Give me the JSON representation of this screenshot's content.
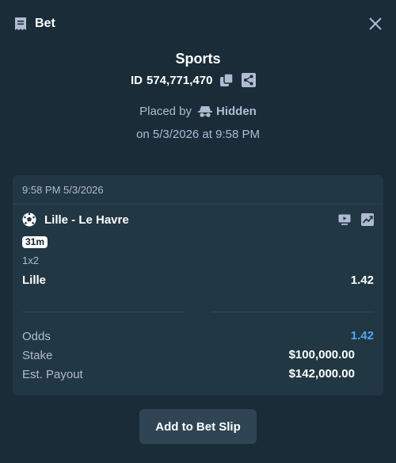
{
  "header": {
    "title": "Bet"
  },
  "bet": {
    "category": "Sports",
    "id_prefix": "ID",
    "id_value": "574,771,470",
    "placed_by_label": "Placed by",
    "placed_by_name": "Hidden",
    "placed_on": "on 5/3/2026 at 9:58 PM"
  },
  "card": {
    "timestamp": "9:58 PM 5/3/2026",
    "event_name": "Lille - Le Havre",
    "live_time": "31m",
    "market": "1x2",
    "selection": "Lille",
    "selection_odds": "1.42",
    "summary": {
      "odds_label": "Odds",
      "odds_value": "1.42",
      "stake_label": "Stake",
      "stake_value": "$100,000.00",
      "payout_label": "Est. Payout",
      "payout_value": "$142,000.00"
    }
  },
  "actions": {
    "add_to_slip": "Add to Bet Slip"
  },
  "icons": {
    "header": "bet-slip-icon",
    "close": "close-icon",
    "copy": "copy-icon",
    "share": "share-icon",
    "incognito": "incognito-icon",
    "sport": "soccer-ball-icon",
    "tv": "live-stream-icon",
    "stats": "stats-icon"
  },
  "colors": {
    "background": "#1a2c38",
    "card": "#213743",
    "accent_odds": "#4ea8f7",
    "muted_text": "#b1bad3"
  }
}
